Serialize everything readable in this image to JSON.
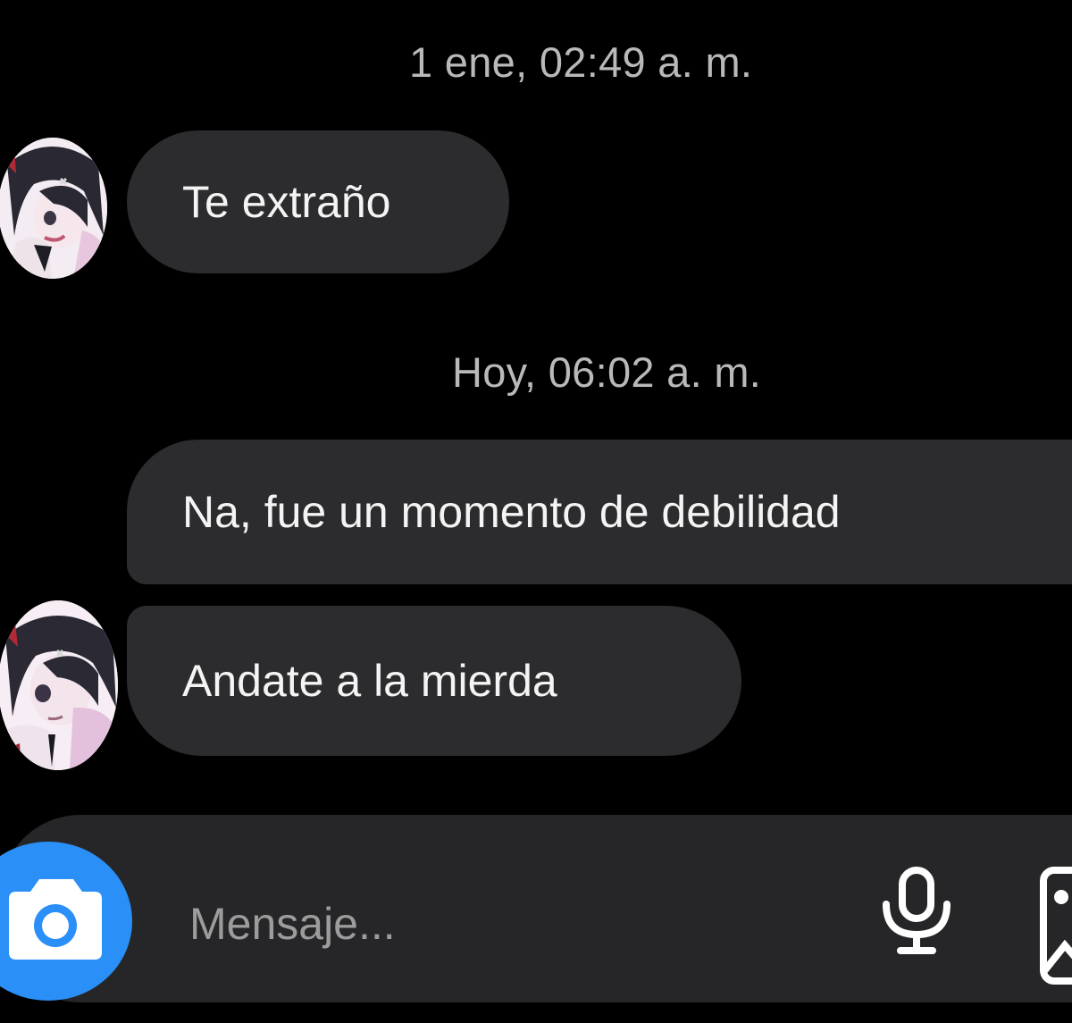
{
  "chat": {
    "messages": [
      {
        "type": "timestamp",
        "text": "1 ene, 02:49 a. m."
      },
      {
        "type": "incoming",
        "sender_avatar": "avatar-anime-girl",
        "text": "Te extraño"
      },
      {
        "type": "timestamp",
        "text": "Hoy, 06:02 a. m."
      },
      {
        "type": "outgoing",
        "text": "Na, fue un momento de debilidad"
      },
      {
        "type": "incoming",
        "sender_avatar": "avatar-anime-girl",
        "text": "Andate a la mierda"
      }
    ]
  },
  "composer": {
    "placeholder": "Mensaje...",
    "icons": [
      "camera-icon",
      "microphone-icon",
      "gallery-icon"
    ]
  },
  "colors": {
    "background": "#000000",
    "bubble": "#2c2c2e",
    "timestamp": "#b9b9b9",
    "camera_accent": "#2a8ff7",
    "composer": "#262628"
  }
}
